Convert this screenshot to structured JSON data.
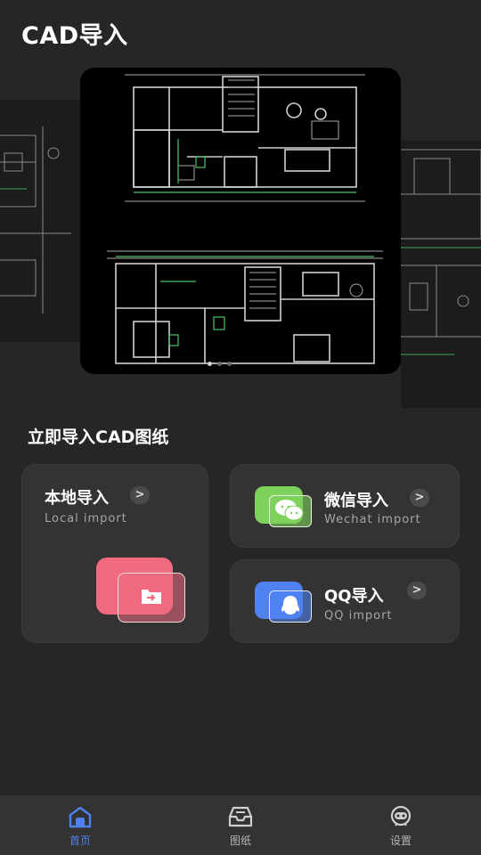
{
  "header": {
    "title": "CAD导入"
  },
  "carousel": {
    "slide_count": 3,
    "active_index": 0
  },
  "section": {
    "heading": "立即导入CAD图纸"
  },
  "import_options": {
    "local": {
      "title": "本地导入",
      "subtitle": "Local import",
      "icon": "folder-import-icon",
      "color": "#f06a80"
    },
    "wechat": {
      "title": "微信导入",
      "subtitle": "Wechat import",
      "icon": "wechat-icon",
      "color": "#7ed25c"
    },
    "qq": {
      "title": "QQ导入",
      "subtitle": "QQ import",
      "icon": "qq-icon",
      "color": "#4f82f0"
    }
  },
  "bottom_nav": {
    "items": [
      {
        "label": "首页",
        "icon": "home-icon",
        "active": true
      },
      {
        "label": "图纸",
        "icon": "drawings-tray-icon",
        "active": false
      },
      {
        "label": "设置",
        "icon": "settings-robot-icon",
        "active": false
      }
    ]
  },
  "colors": {
    "background": "#262626",
    "card": "#333333",
    "accent": "#4f82f0",
    "cad_line": "#d8d8d8",
    "cad_green": "#4cc46a"
  }
}
